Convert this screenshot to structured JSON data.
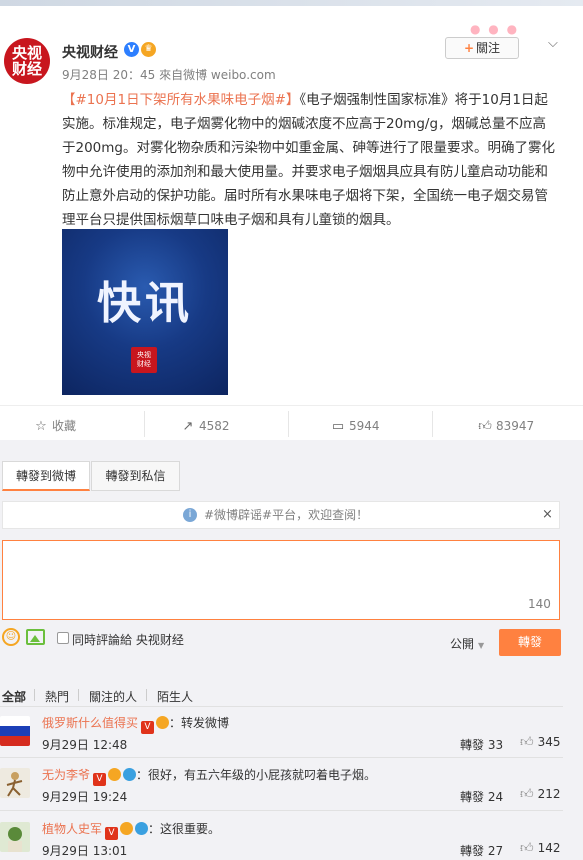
{
  "post": {
    "author": "央视财经",
    "avatar_text_1": "央视",
    "avatar_text_2": "财经",
    "timestamp": "9月28日 20：45",
    "source": "來自微博 weibo.com",
    "follow_label": "關注",
    "topic": "【#10月1日下架所有水果味电子烟#】",
    "body": "《电子烟强制性国家标准》将于10月1日起实施。标准规定，电子烟雾化物中的烟碱浓度不应高于20mg/g，烟碱总量不应高于200mg。对雾化物杂质和污染物中如重金属、砷等进行了限量要求。明确了雾化物中允许使用的添加剂和最大使用量。并要求电子烟烟具应具有防儿童启动功能和防止意外启动的保护功能。届时所有水果味电子烟将下架，全国统一电子烟交易管理平台只提供国标烟草口味电子烟和具有儿童锁的烟具。",
    "image_text": "快讯",
    "image_logo_1": "央视",
    "image_logo_2": "财经"
  },
  "actions": {
    "favorite_label": "收藏",
    "repost_count": "4582",
    "comment_count": "5944",
    "like_count": "83947"
  },
  "repost_panel": {
    "tab_weibo": "轉發到微博",
    "tab_private": "轉發到私信",
    "notice": "#微博辟谣#平台，欢迎查阅！",
    "close": "×",
    "counter": "140",
    "also_comment_label": "同時評論給 央视财经",
    "visibility": "公開",
    "submit_label": "轉發"
  },
  "filters": [
    "全部",
    "熱門",
    "關注的人",
    "陌生人"
  ],
  "reposts": [
    {
      "user": "俄罗斯什么值得买",
      "text": "：转发微博",
      "date": "9月29日 12:48",
      "repost_label": "轉發 33",
      "likes": "345"
    },
    {
      "user": "无为李爷",
      "text": "：很好，有五六年级的小屁孩就叼着电子烟。",
      "date": "9月29日 19:24",
      "repost_label": "轉發 24",
      "likes": "212"
    },
    {
      "user": "植物人史军",
      "text": "：这很重要。",
      "date": "9月29日 13:01",
      "repost_label": "轉發 27",
      "likes": "142"
    }
  ],
  "colors": {
    "accent": "#ff8140",
    "link": "#eb7350",
    "brand_red": "#c8161e"
  }
}
